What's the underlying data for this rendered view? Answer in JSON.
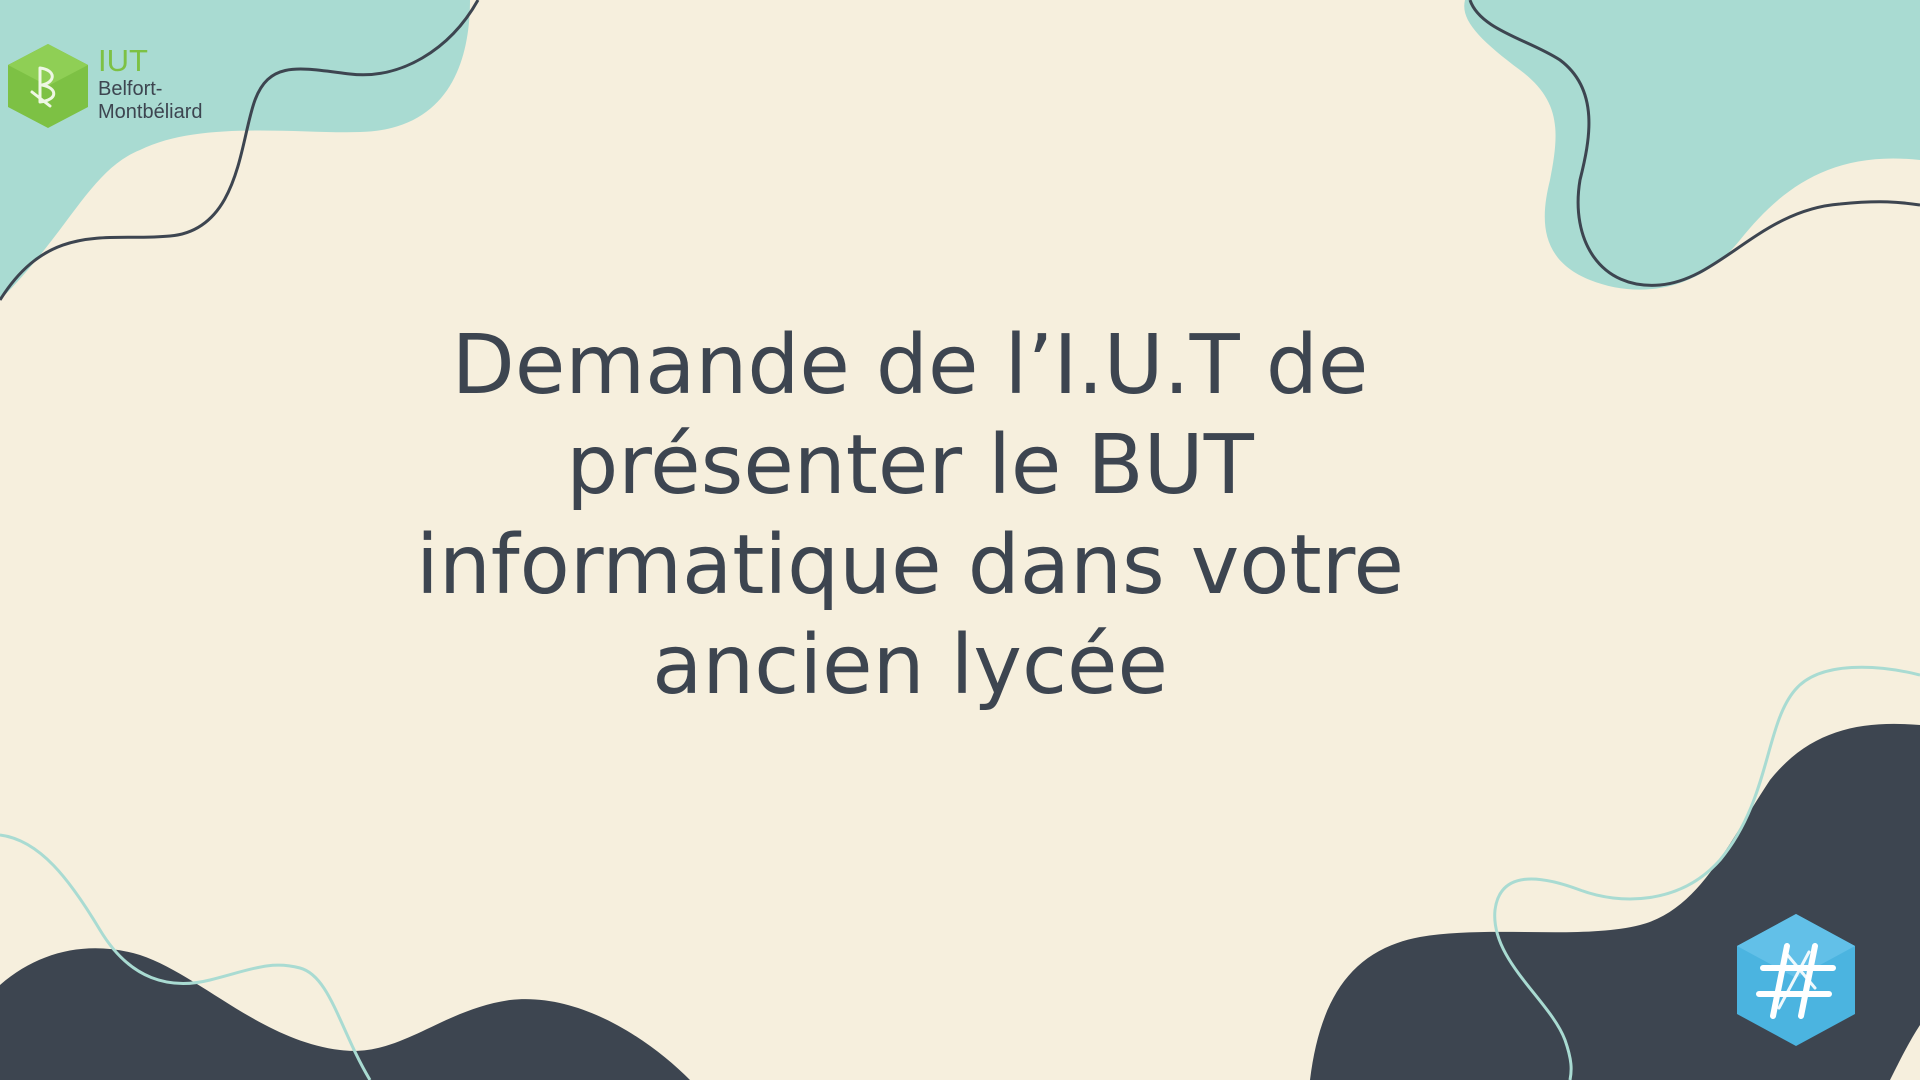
{
  "logo": {
    "line1": "IUT",
    "line2": "Belfort-",
    "line3": "Montbéliard"
  },
  "title": {
    "lines": [
      "Demande de l’I.U.T de",
      "présenter le BUT",
      "informatique dans votre",
      "ancien lycée"
    ]
  },
  "icons": {
    "logo_icon": "iut-hexagon-logo-icon",
    "corner_icon": "hashtag-hexagon-icon"
  },
  "colors": {
    "background": "#f6efdd",
    "mint": "#a9dbd2",
    "navy": "#3d4550",
    "logo_green": "#7dc144",
    "badge_blue": "#4bb4e0"
  }
}
